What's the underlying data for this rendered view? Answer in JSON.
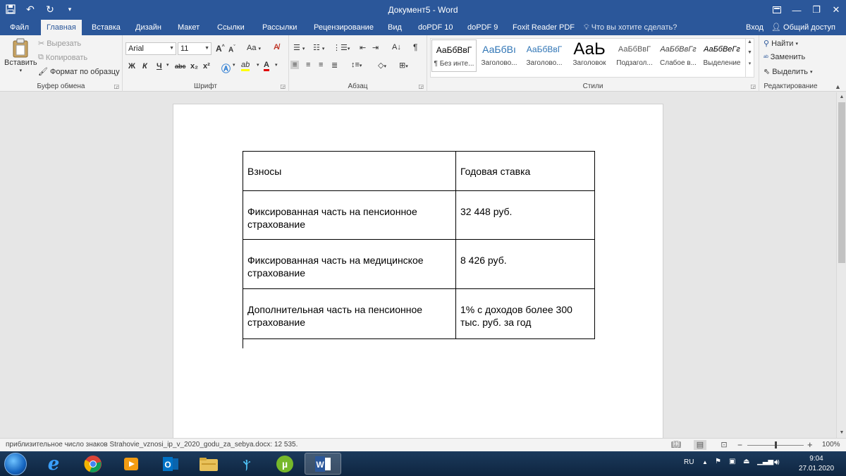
{
  "window": {
    "title": "Документ5 - Word"
  },
  "tabs": [
    {
      "label": "Файл"
    },
    {
      "label": "Главная"
    },
    {
      "label": "Вставка"
    },
    {
      "label": "Дизайн"
    },
    {
      "label": "Макет"
    },
    {
      "label": "Ссылки"
    },
    {
      "label": "Рассылки"
    },
    {
      "label": "Рецензирование"
    },
    {
      "label": "Вид"
    },
    {
      "label": "doPDF 10"
    },
    {
      "label": "doPDF 9"
    },
    {
      "label": "Foxit Reader PDF"
    }
  ],
  "tell_me": "Что вы хотите сделать?",
  "sign_in": "Вход",
  "share": "Общий доступ",
  "clipboard": {
    "paste": "Вставить",
    "cut": "Вырезать",
    "copy": "Копировать",
    "format_painter": "Формат по образцу",
    "label": "Буфер обмена"
  },
  "font": {
    "name": "Arial",
    "size": "11",
    "label": "Шрифт",
    "bold": "Ж",
    "italic": "К",
    "underline": "Ч",
    "strike": "abc",
    "subscript": "x₂",
    "superscript": "x²",
    "grow": "A",
    "shrink": "A",
    "case": "Aa",
    "highlight": "ab",
    "color": "A"
  },
  "paragraph": {
    "label": "Абзац"
  },
  "styles": {
    "label": "Стили",
    "items": [
      {
        "preview": "АаБбВвГ",
        "name": "¶ Без инте..."
      },
      {
        "preview": "АаБбВı",
        "name": "Заголово..."
      },
      {
        "preview": "АаБбВвГ",
        "name": "Заголово..."
      },
      {
        "preview": "АаЬ",
        "name": "Заголовок"
      },
      {
        "preview": "АаБбВвГ",
        "name": "Подзагол..."
      },
      {
        "preview": "АаБбВвГг",
        "name": "Слабое в..."
      },
      {
        "preview": "АаБбВеГг",
        "name": "Выделение"
      }
    ]
  },
  "editing": {
    "label": "Редактирование",
    "find": "Найти",
    "replace": "Заменить",
    "select": "Выделить"
  },
  "document": {
    "table": [
      {
        "col1": "Взносы",
        "col2": "Годовая ставка"
      },
      {
        "col1": "Фиксированная часть на пенсионное страхование",
        "col2": "32 448 руб."
      },
      {
        "col1": "Фиксированная часть на медицинское страхование",
        "col2": "8 426 руб."
      },
      {
        "col1": "Дополнительная часть на пенсионное страхование",
        "col2": "1% с доходов более 300 тыс. руб. за год"
      }
    ]
  },
  "status": {
    "text": "приблизительное число знаков Strahovie_vznosi_ip_v_2020_godu_za_sebya.docx: 12 535.",
    "zoom": "100%"
  },
  "taskbar": {
    "language": "RU",
    "time": "9:04",
    "date": "27.01.2020"
  }
}
